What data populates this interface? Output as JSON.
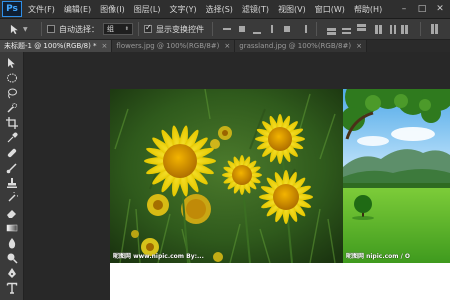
{
  "app": {
    "logo": "Ps"
  },
  "menu": {
    "items": [
      "文件(F)",
      "编辑(E)",
      "图像(I)",
      "图层(L)",
      "文字(Y)",
      "选择(S)",
      "滤镜(T)",
      "视图(V)",
      "窗口(W)",
      "帮助(H)"
    ]
  },
  "window_controls": {
    "minimize": "–",
    "maximize": "□",
    "close": "✕"
  },
  "options": {
    "auto_select_label": "自动选择：",
    "auto_select_checked": false,
    "auto_select_value": "组",
    "show_transform_label": "显示变换控件",
    "show_transform_checked": true
  },
  "tabs": [
    {
      "label": "未标题-1 @ 100%(RGB/8) *",
      "close": "×",
      "active": true
    },
    {
      "label": "flowers.jpg @ 100%(RGB/8#)",
      "close": "×",
      "active": false
    },
    {
      "label": "grassland.jpg @ 100%(RGB/8#)",
      "close": "×",
      "active": false
    }
  ],
  "tools": [
    "move-tool",
    "marquee-tool",
    "lasso-tool",
    "quick-select-tool",
    "crop-tool",
    "eyedropper-tool",
    "healing-brush-tool",
    "brush-tool",
    "clone-stamp-tool",
    "history-brush-tool",
    "eraser-tool",
    "gradient-tool",
    "blur-tool",
    "dodge-tool",
    "pen-tool",
    "type-tool"
  ],
  "canvas": {
    "photo1_watermark": "昵图网 www.nipic.com  By:...",
    "photo2_watermark": "昵图网 nipic.com / O"
  },
  "colors": {
    "accent": "#2f8fe8",
    "panel": "#3a3a3a",
    "workspace": "#282828",
    "canvas": "#ffffff"
  }
}
